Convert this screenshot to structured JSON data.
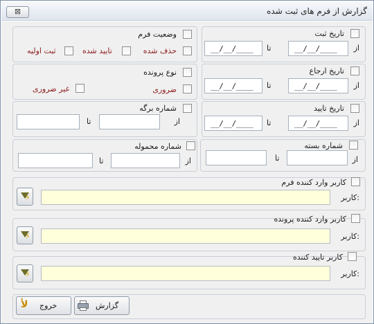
{
  "window": {
    "title": "گزارش از فرم های ثبت شده",
    "close_label": "⊠"
  },
  "common": {
    "from": "از",
    "to": "تا",
    "date_placeholder": "__/__/____",
    "user_label": "کاربر:"
  },
  "sections": {
    "registration_date": "تاریخ ثبت",
    "referral_date": "تاریخ ارجاع",
    "approval_date": "تاریخ تایید",
    "package_number": "شماره بسته",
    "form_status": "وضعیت فرم",
    "status_deleted": "حذف شده",
    "status_approved": "تایید شده",
    "status_initial": "ثبت اولیه",
    "file_type": "نوع پرونده",
    "type_required": "ضروری",
    "type_not_required": "غیر ضروری",
    "sheet_number": "شماره برگه",
    "shipment_number": "شماره محموله",
    "form_entry_user": "کاربر وارد کننده فرم",
    "file_entry_user": "کاربر وارد کننده پرونده",
    "approver_user": "کاربر تایید کننده"
  },
  "buttons": {
    "report": "گزارش",
    "exit": "خروج"
  }
}
